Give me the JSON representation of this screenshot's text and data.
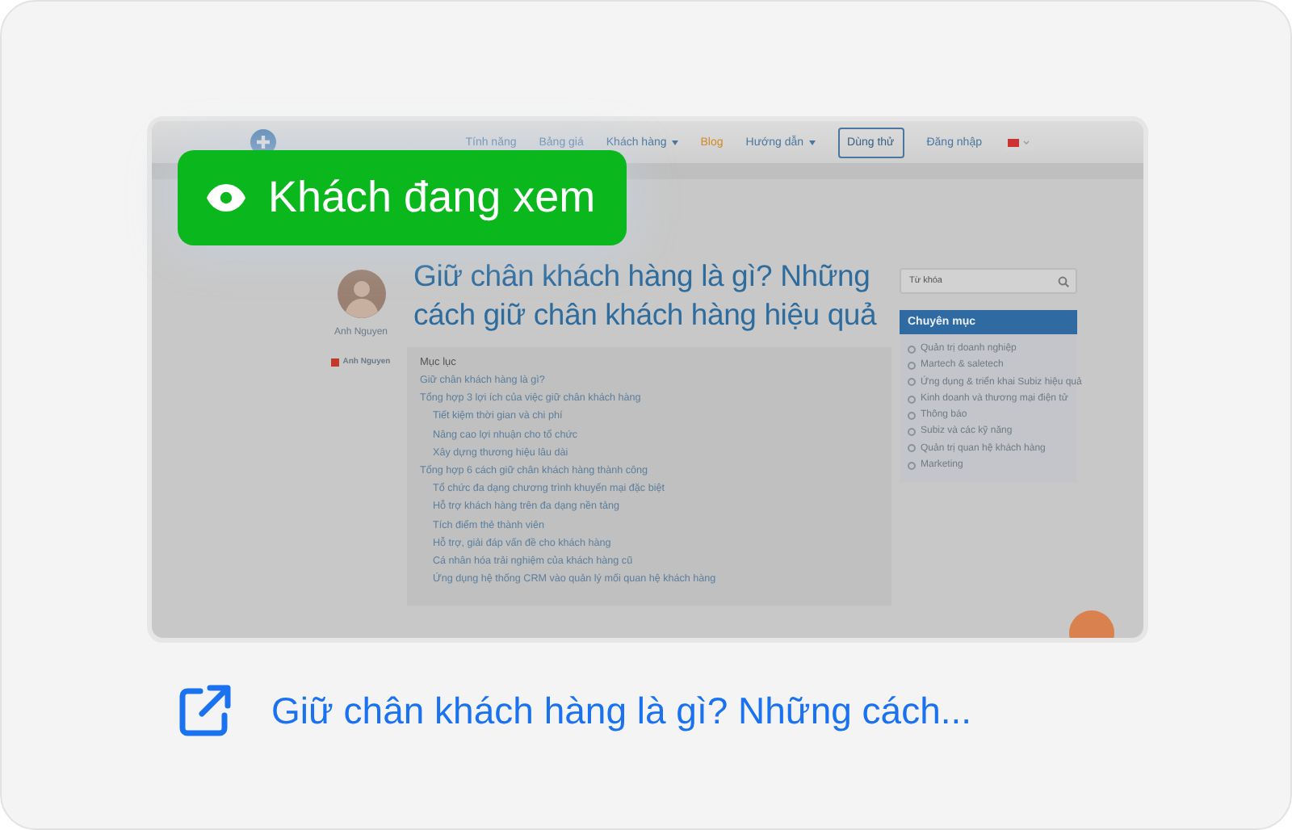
{
  "badge": {
    "label": "Khách đang xem"
  },
  "site": {
    "nav": [
      {
        "label": "Tính năng",
        "kind": "link"
      },
      {
        "label": "Bảng giá",
        "kind": "link"
      },
      {
        "label": "Khách hàng",
        "kind": "dropdown"
      },
      {
        "label": "Blog",
        "kind": "highlight"
      },
      {
        "label": "Hướng dẫn",
        "kind": "dropdown"
      },
      {
        "label": "Dùng thử",
        "kind": "outlined"
      },
      {
        "label": "Đăng nhập",
        "kind": "link"
      }
    ],
    "author": {
      "name": "Anh Nguyen",
      "tag": "Anh Nguyen"
    },
    "title": "Giữ chân khách hàng là gì? Những cách giữ chân khách hàng hiệu quả",
    "toc": {
      "heading": "Mục lục",
      "items": [
        {
          "label": "Giữ chân khách hàng là gì?"
        },
        {
          "label": "Tổng hợp 3 lợi ích của việc giữ chân khách hàng",
          "children": [
            {
              "label": "Tiết kiệm thời gian và chi phí"
            },
            {
              "label": "Nâng cao lợi nhuận cho tổ chức"
            },
            {
              "label": "Xây dựng thương hiệu lâu dài"
            }
          ]
        },
        {
          "label": "Tổng hợp 6 cách giữ chân khách hàng thành công",
          "children": [
            {
              "label": "Tổ chức đa dạng chương trình khuyến mại đặc biệt"
            },
            {
              "label": "Hỗ trợ khách hàng trên đa dạng nền tảng"
            },
            {
              "label": "Tích điểm thẻ thành viên"
            },
            {
              "label": "Hỗ trợ, giải đáp vấn đề cho khách hàng"
            },
            {
              "label": "Cá nhân hóa trải nghiệm của khách hàng cũ"
            },
            {
              "label": "Ứng dụng hệ thống CRM vào quản lý mối quan hệ khách hàng"
            }
          ]
        }
      ]
    },
    "search": {
      "placeholder": "Từ khóa"
    },
    "categories": {
      "heading": "Chuyên mục",
      "items": [
        "Quản trị doanh nghiệp",
        "Martech & saletech",
        "Ứng dụng & triển khai Subiz hiệu quả",
        "Kinh doanh và thương mại điện tử",
        "Thông báo",
        "Subiz và các kỹ năng",
        "Quản trị quan hệ khách hàng",
        "Marketing"
      ]
    }
  },
  "link": {
    "label": "Giữ chân khách hàng là gì? Những cách..."
  }
}
